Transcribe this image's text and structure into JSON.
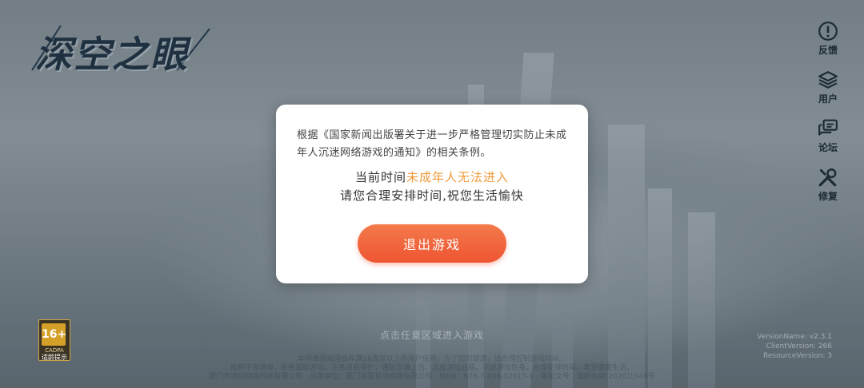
{
  "game": {
    "logo_text": "深空之眼"
  },
  "sidebar": {
    "items": [
      {
        "label": "反馈",
        "icon": "alert-circle-icon"
      },
      {
        "label": "用户",
        "icon": "layers-icon"
      },
      {
        "label": "论坛",
        "icon": "chat-bubbles-icon"
      },
      {
        "label": "修复",
        "icon": "wrench-screwdriver-icon"
      }
    ]
  },
  "age_rating": {
    "value": "16+",
    "sub": "CADPA",
    "tip": "适龄提示"
  },
  "modal": {
    "notice": "根据《国家新闻出版署关于进一步严格管理切实防止未成年人沉迷网络游戏的通知》的相关条例。",
    "line1_prefix": "当前时间",
    "line1_highlight": "未成年人无法进入",
    "line2": "请您合理安排时间,祝您生活愉快",
    "exit_button": "退出游戏",
    "highlight_color": "#ef9a3a",
    "button_color": "#ee5532"
  },
  "enter_hint": "点击任意区域进入游戏",
  "version": {
    "version_name": "VersionName: v2.3.1",
    "client_version": "ClientVersion: 266",
    "resource_version": "ResourceVersion: 3"
  },
  "footer": {
    "line1": "本网络游戏适合年满16周岁以上的用户使用；为了您的健康，请合理控制游戏时间。",
    "line2": "抵制不良游戏，拒绝盗版游戏。注意自我保护，谨防受骗上当。适度游戏益脑，沉迷游戏伤身。合理安排时间，享受健康生活。",
    "line3": "厦门市游动网络科技有限公司　出版单位：厦门雷霆互动网络有限公司　ISBN：978-7-498-02615-1　审批文号：国新出审[2020]1546号"
  }
}
